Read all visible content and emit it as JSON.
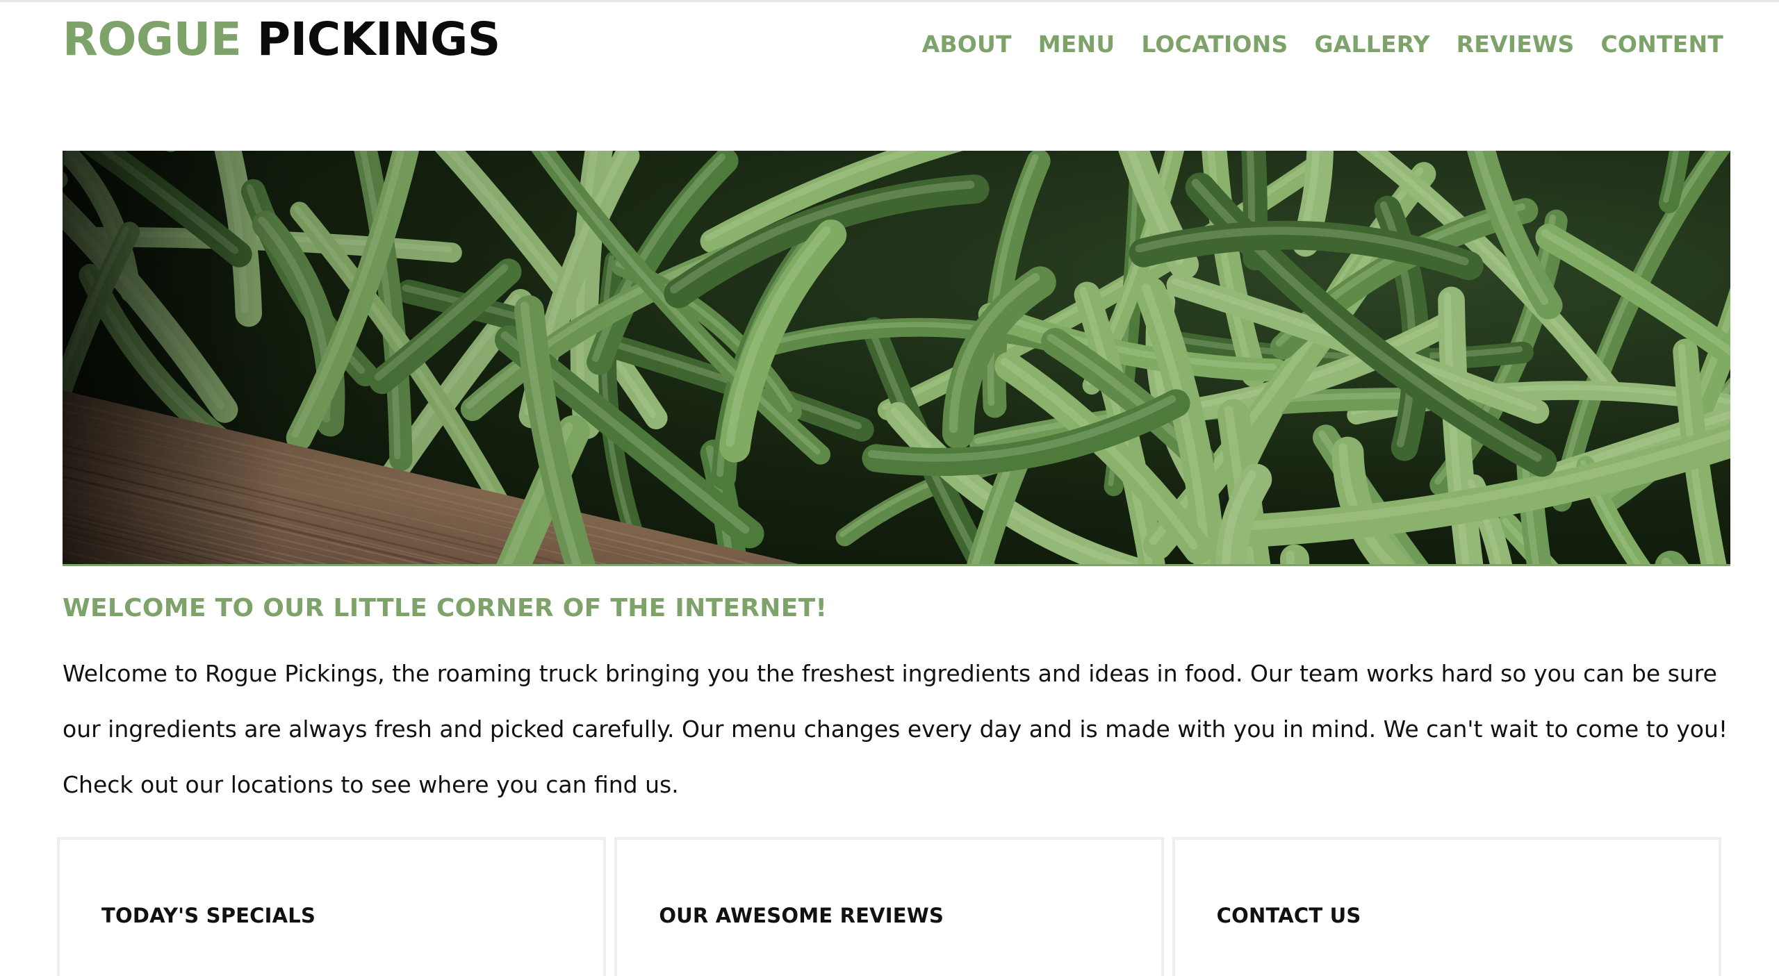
{
  "header": {
    "brand_first": "ROGUE",
    "brand_second": "PICKINGS",
    "nav": [
      "ABOUT",
      "MENU",
      "LOCATIONS",
      "GALLERY",
      "REVIEWS",
      "CONTENT"
    ]
  },
  "hero": {
    "image": "green-beans-photo"
  },
  "welcome": {
    "heading": "WELCOME TO OUR LITTLE CORNER OF THE INTERNET!",
    "body": "Welcome to Rogue Pickings, the roaming truck bringing you the freshest ingredients and ideas in food. Our team works hard so you can be sure our ingredients are always fresh and picked carefully. Our menu changes every day and is made with you in mind. We can't wait to come to you! Check out our locations to see where you can find us."
  },
  "cards": [
    {
      "title": "TODAY'S SPECIALS"
    },
    {
      "title": "OUR AWESOME REVIEWS"
    },
    {
      "title": "CONTACT US"
    }
  ],
  "colors": {
    "accent": "#7ea36a",
    "text": "#111111"
  }
}
